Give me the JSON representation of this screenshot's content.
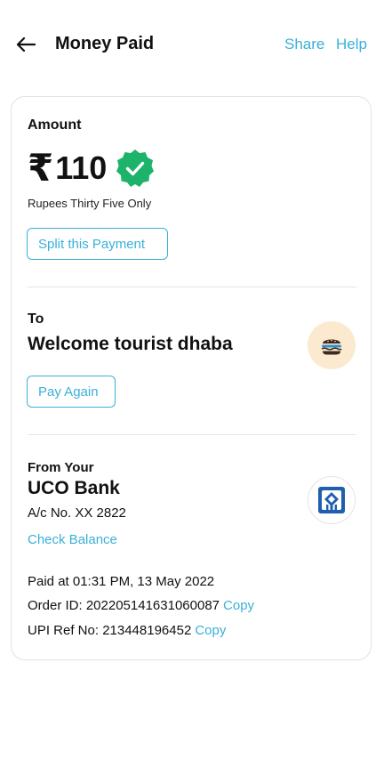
{
  "header": {
    "title": "Money Paid",
    "share_label": "Share",
    "help_label": "Help",
    "back_icon": "arrow-left-icon"
  },
  "amount_section": {
    "label": "Amount",
    "currency_symbol": "₹",
    "value": "110",
    "in_words": "Rupees Thirty Five Only",
    "split_button_label": "Split this Payment",
    "badge_icon": "verified-check-icon"
  },
  "to_section": {
    "label": "To",
    "merchant_name": "Welcome tourist dhaba",
    "pay_again_label": "Pay Again",
    "avatar_icon": "burger-icon"
  },
  "from_section": {
    "label": "From Your",
    "bank_name": "UCO Bank",
    "account": "A/c No. XX 2822",
    "check_balance_label": "Check Balance",
    "logo_icon": "uco-bank-logo-icon"
  },
  "details": {
    "paid_at": "Paid at 01:31 PM, 13 May 2022",
    "order_id_text": "Order ID: 202205141631060087",
    "upi_ref_text": "UPI Ref No: 213448196452",
    "copy_label": "Copy"
  },
  "colors": {
    "accent": "#3ab0d8",
    "verified_green": "#1db36b",
    "avatar_bg": "#fbeacf",
    "bank_blue": "#1f5fae"
  }
}
